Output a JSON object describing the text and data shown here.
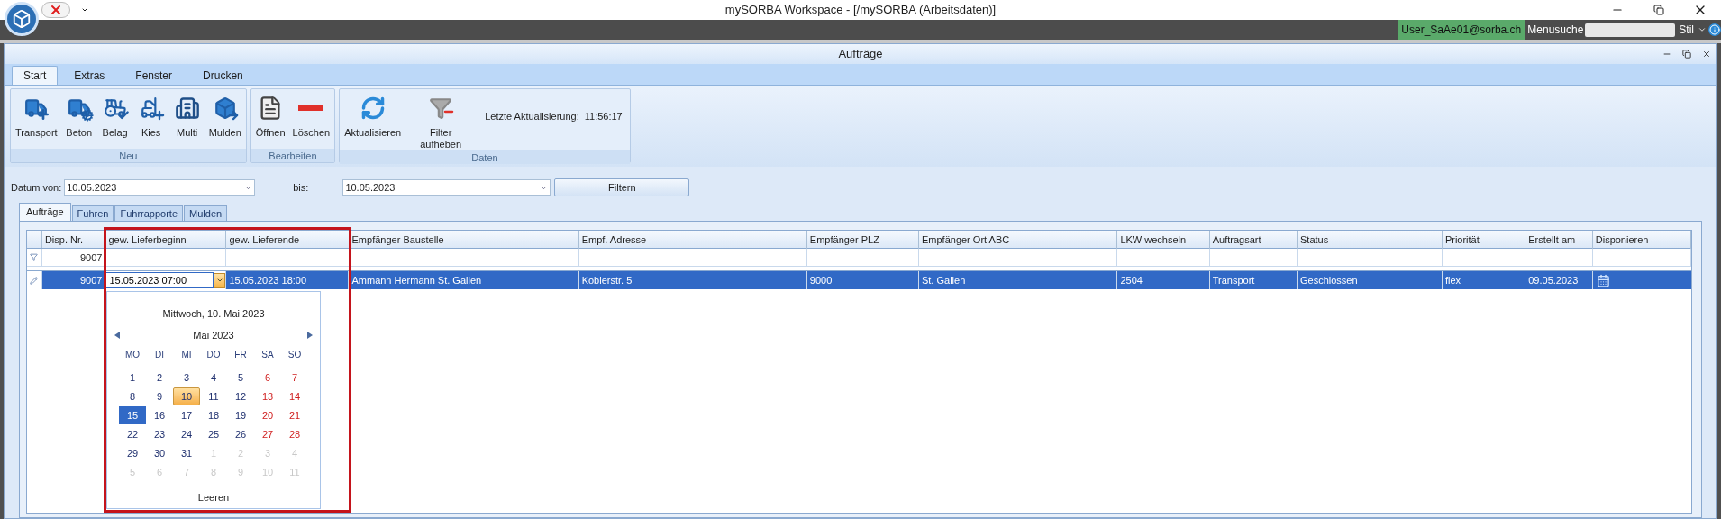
{
  "app": {
    "title": "mySORBA Workspace - [/mySORBA (Arbeitsdaten)]",
    "user": "User_SaAe01@sorba.ch",
    "menu_search_label": "Menusuche",
    "style_label": "Stil"
  },
  "window": {
    "title": "Aufträge"
  },
  "ribbon": {
    "tabs": [
      {
        "label": "Start",
        "selected": true
      },
      {
        "label": "Extras",
        "selected": false
      },
      {
        "label": "Fenster",
        "selected": false
      },
      {
        "label": "Drucken",
        "selected": false
      }
    ],
    "groups": [
      {
        "label": "Neu",
        "buttons": [
          "Transport",
          "Beton",
          "Belag",
          "Kies",
          "Multi",
          "Mulden"
        ]
      },
      {
        "label": "Bearbeiten",
        "buttons": [
          "Öffnen",
          "Löschen"
        ]
      },
      {
        "label": "Daten",
        "buttons": [
          "Aktualisieren",
          "Filter aufheben"
        ],
        "info": {
          "label": "Letzte Aktualisierung:",
          "time": "11:56:17"
        }
      }
    ]
  },
  "filter": {
    "from": {
      "label": "Datum von:",
      "value": "10.05.2023"
    },
    "to": {
      "label": "bis:",
      "value": "10.05.2023"
    },
    "button": "Filtern"
  },
  "tabs": [
    {
      "label": "Aufträge",
      "selected": true
    },
    {
      "label": "Fuhren",
      "selected": false
    },
    {
      "label": "Fuhrrapporte",
      "selected": false
    },
    {
      "label": "Mulden",
      "selected": false
    }
  ],
  "grid": {
    "columns": [
      "Disp. Nr.",
      "gew. Lieferbeginn",
      "gew. Lieferende",
      "Empfänger Baustelle",
      "Empf. Adresse",
      "Empfänger PLZ",
      "Empfänger Ort ABC",
      "LKW wechseln",
      "Auftragsart",
      "Status",
      "Priorität",
      "Erstellt am",
      "Disponieren"
    ],
    "filter_row": {
      "disp_nr": "9007"
    },
    "rows": [
      {
        "selected": true,
        "cells": [
          {
            "kind": "number",
            "text": "9007"
          },
          {
            "kind": "editor",
            "text": "15.05.2023 07:00"
          },
          {
            "kind": "text",
            "text": "15.05.2023 18:00"
          },
          {
            "kind": "text",
            "text": "Ammann Hermann St. Gallen"
          },
          {
            "kind": "text",
            "text": "Koblerstr. 5"
          },
          {
            "kind": "text",
            "text": "9000"
          },
          {
            "kind": "text",
            "text": "St. Gallen"
          },
          {
            "kind": "text",
            "text": "2504"
          },
          {
            "kind": "text",
            "text": "Transport"
          },
          {
            "kind": "text",
            "text": "Geschlossen"
          },
          {
            "kind": "text",
            "text": "flex"
          },
          {
            "kind": "text",
            "text": "09.05.2023"
          },
          {
            "kind": "icon"
          }
        ]
      }
    ]
  },
  "calendar": {
    "header": "Mittwoch, 10. Mai 2023",
    "month": "Mai 2023",
    "weekdays": [
      "MO",
      "DI",
      "MI",
      "DO",
      "FR",
      "SA",
      "SO"
    ],
    "weeks": [
      [
        {
          "label": "1",
          "kind": "weekday",
          "selected": false
        },
        {
          "label": "2",
          "kind": "weekday",
          "selected": false
        },
        {
          "label": "3",
          "kind": "weekday",
          "selected": false
        },
        {
          "label": "4",
          "kind": "weekday",
          "selected": false
        },
        {
          "label": "5",
          "kind": "weekday",
          "selected": false
        },
        {
          "label": "6",
          "kind": "weekend",
          "selected": false
        },
        {
          "label": "7",
          "kind": "weekend",
          "selected": false
        }
      ],
      [
        {
          "label": "8",
          "kind": "weekday",
          "selected": false
        },
        {
          "label": "9",
          "kind": "weekday",
          "selected": false
        },
        {
          "label": "10",
          "kind": "today",
          "selected": false
        },
        {
          "label": "11",
          "kind": "weekday",
          "selected": false
        },
        {
          "label": "12",
          "kind": "weekday",
          "selected": false
        },
        {
          "label": "13",
          "kind": "weekend",
          "selected": false
        },
        {
          "label": "14",
          "kind": "weekend",
          "selected": false
        }
      ],
      [
        {
          "label": "15",
          "kind": "weekday",
          "selected": true
        },
        {
          "label": "16",
          "kind": "weekday",
          "selected": false
        },
        {
          "label": "17",
          "kind": "weekday",
          "selected": false
        },
        {
          "label": "18",
          "kind": "weekday",
          "selected": false
        },
        {
          "label": "19",
          "kind": "weekday",
          "selected": false
        },
        {
          "label": "20",
          "kind": "weekend",
          "selected": false
        },
        {
          "label": "21",
          "kind": "weekend",
          "selected": false
        }
      ],
      [
        {
          "label": "22",
          "kind": "weekday",
          "selected": false
        },
        {
          "label": "23",
          "kind": "weekday",
          "selected": false
        },
        {
          "label": "24",
          "kind": "weekday",
          "selected": false
        },
        {
          "label": "25",
          "kind": "weekday",
          "selected": false
        },
        {
          "label": "26",
          "kind": "weekday",
          "selected": false
        },
        {
          "label": "27",
          "kind": "weekend",
          "selected": false
        },
        {
          "label": "28",
          "kind": "weekend",
          "selected": false
        }
      ],
      [
        {
          "label": "29",
          "kind": "weekday",
          "selected": false
        },
        {
          "label": "30",
          "kind": "weekday",
          "selected": false
        },
        {
          "label": "31",
          "kind": "weekday",
          "selected": false
        },
        {
          "label": "1",
          "kind": "other",
          "selected": false
        },
        {
          "label": "2",
          "kind": "other",
          "selected": false
        },
        {
          "label": "3",
          "kind": "other",
          "selected": false
        },
        {
          "label": "4",
          "kind": "other",
          "selected": false
        }
      ],
      [
        {
          "label": "5",
          "kind": "other",
          "selected": false
        },
        {
          "label": "6",
          "kind": "other",
          "selected": false
        },
        {
          "label": "7",
          "kind": "other",
          "selected": false
        },
        {
          "label": "8",
          "kind": "other",
          "selected": false
        },
        {
          "label": "9",
          "kind": "other",
          "selected": false
        },
        {
          "label": "10",
          "kind": "other",
          "selected": false
        },
        {
          "label": "11",
          "kind": "other",
          "selected": false
        }
      ]
    ],
    "clear": "Leeren"
  }
}
